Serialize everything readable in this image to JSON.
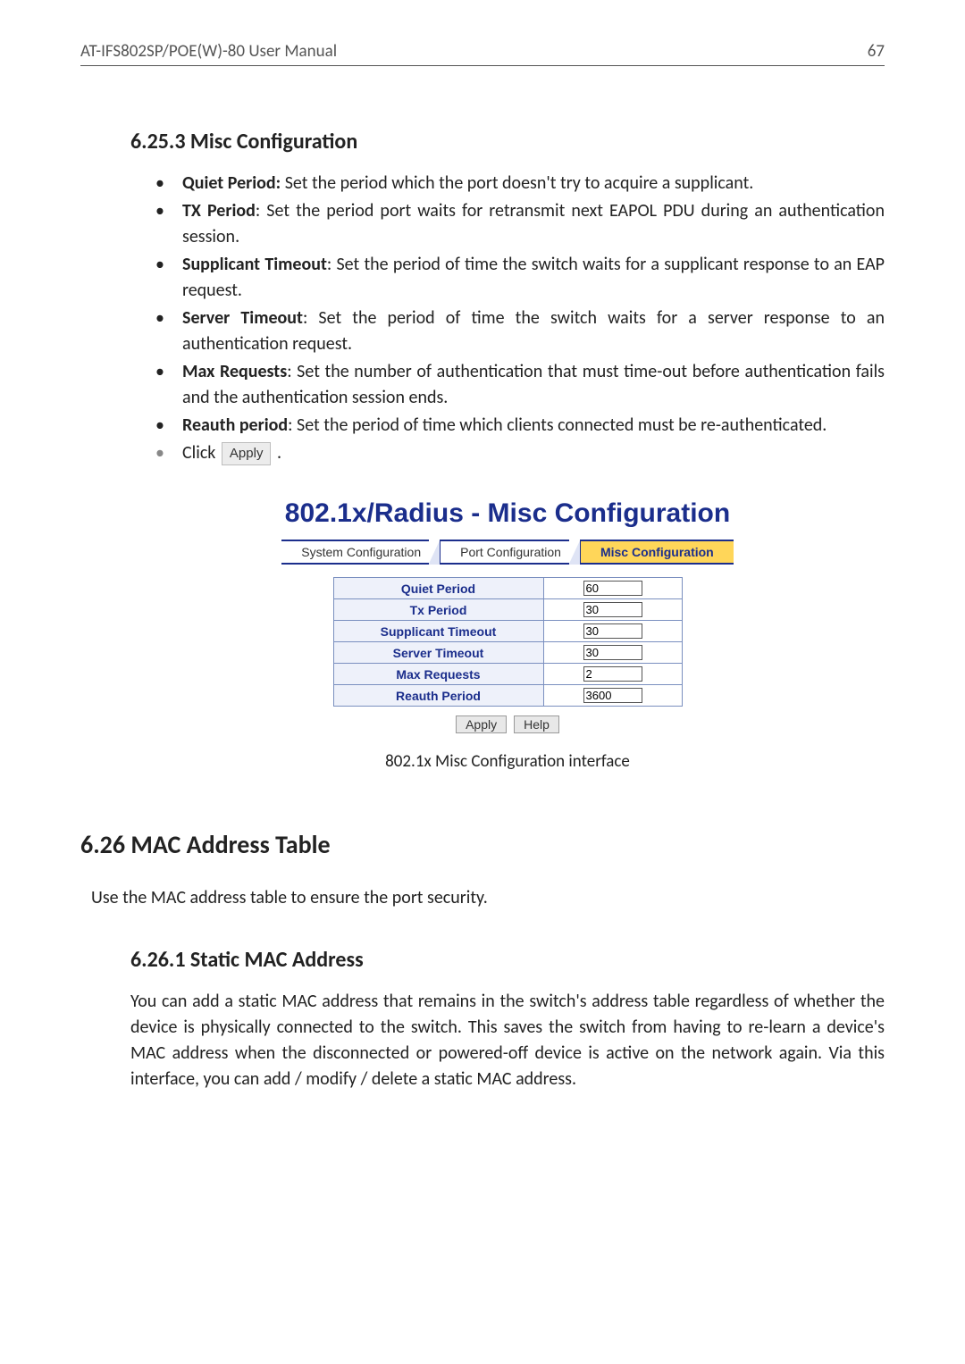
{
  "header": {
    "left": "AT-IFS802SP/POE(W)-80 User Manual",
    "right": "67"
  },
  "section_6_25_3": {
    "heading": "6.25.3  Misc Configuration",
    "bullets": [
      {
        "bold": "Quiet Period:",
        "rest": " Set the period which the port doesn't try to acquire a supplicant."
      },
      {
        "bold": "TX Period",
        "rest": ": Set the period port waits for retransmit next EAPOL PDU during an authentication session."
      },
      {
        "bold": "Supplicant Timeout",
        "rest": ": Set the period of time the switch waits for a supplicant response to an EAP request."
      },
      {
        "bold": "Server Timeout",
        "rest": ": Set the period of time the switch waits for a server response to an authentication request."
      },
      {
        "bold": "Max Requests",
        "rest": ": Set the number of authentication that must time-out before authentication fails and the authentication session ends."
      },
      {
        "bold": "Reauth period",
        "rest": ": Set the period of time which clients connected must be re-authenticated."
      }
    ],
    "click_prefix": "Click ",
    "click_button": "Apply",
    "click_suffix": "  ."
  },
  "figure": {
    "title": "802.1x/Radius - Misc Configuration",
    "tabs": [
      {
        "label": "System Configuration",
        "active": false
      },
      {
        "label": "Port Configuration",
        "active": false
      },
      {
        "label": "Misc Configuration",
        "active": true
      }
    ],
    "rows": [
      {
        "label": "Quiet Period",
        "value": "60"
      },
      {
        "label": "Tx Period",
        "value": "30"
      },
      {
        "label": "Supplicant Timeout",
        "value": "30"
      },
      {
        "label": "Server Timeout",
        "value": "30"
      },
      {
        "label": "Max Requests",
        "value": "2"
      },
      {
        "label": "Reauth Period",
        "value": "3600"
      }
    ],
    "buttons": {
      "apply": "Apply",
      "help": "Help"
    },
    "caption": "802.1x Misc Configuration interface"
  },
  "section_6_26": {
    "heading": "6.26  MAC Address Table",
    "intro": "Use the MAC address table to ensure the port security."
  },
  "section_6_26_1": {
    "heading": "6.26.1  Static MAC Address",
    "body": "You can add a static MAC address that remains in the switch's address table regardless of whether the device is physically connected to the switch. This saves the switch from having to re-learn a device's MAC address when the disconnected or powered-off device is active on the network again. Via this interface, you can add / modify / delete a static MAC address."
  }
}
